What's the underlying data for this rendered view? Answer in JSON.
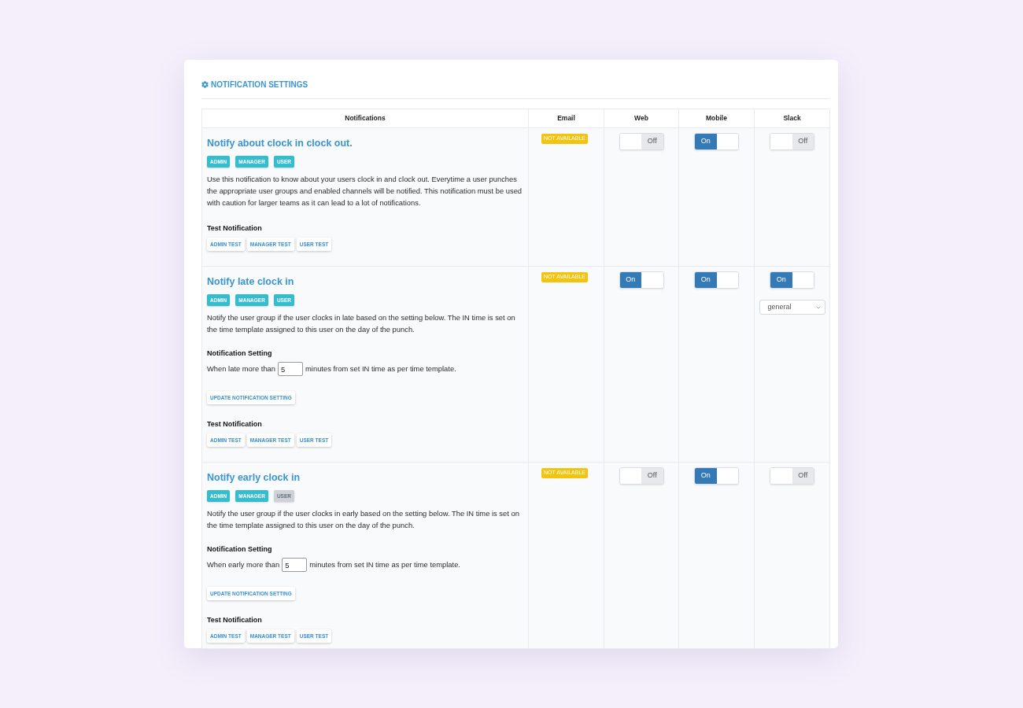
{
  "header": {
    "title": "NOTIFICATION SETTINGS"
  },
  "table": {
    "columns": [
      "Notifications",
      "Email",
      "Web",
      "Mobile",
      "Slack"
    ],
    "rows": [
      {
        "title": "Notify about clock in clock out.",
        "roles": [
          {
            "label": "ADMIN",
            "enabled": true
          },
          {
            "label": "MANAGER",
            "enabled": true
          },
          {
            "label": "USER",
            "enabled": true
          }
        ],
        "description": "Use this notification to know about your users clock in and clock out. Everytime a user punches the appropriate user groups and enabled channels will be notified. This notification must be used with caution for larger teams as it can lead to a lot of notifications.",
        "test": {
          "heading": "Test Notification",
          "buttons": [
            "ADMIN TEST",
            "MANAGER TEST",
            "USER TEST"
          ]
        },
        "channels": [
          {
            "kind": "badge",
            "label": "NOT AVAILABLE"
          },
          {
            "kind": "toggle",
            "label": "Off",
            "on": false
          },
          {
            "kind": "toggle",
            "label": "On",
            "on": true
          },
          {
            "kind": "toggle",
            "label": "Off",
            "on": false
          }
        ]
      },
      {
        "title": "Notify late clock in",
        "roles": [
          {
            "label": "ADMIN",
            "enabled": true
          },
          {
            "label": "MANAGER",
            "enabled": true
          },
          {
            "label": "USER",
            "enabled": true
          }
        ],
        "description": "Notify the user group if the user clocks in late based on the setting below. The IN time is set on the time template assigned to this user on the day of the punch.",
        "setting": {
          "heading": "Notification Setting",
          "prefix": "When late more than",
          "value": "5",
          "suffix": "minutes from set IN time as per time template.",
          "button": "UPDATE NOTIFICATION SETTING"
        },
        "test": {
          "heading": "Test Notification",
          "buttons": [
            "ADMIN TEST",
            "MANAGER TEST",
            "USER TEST"
          ]
        },
        "channels": [
          {
            "kind": "badge",
            "label": "NOT AVAILABLE"
          },
          {
            "kind": "toggle",
            "label": "On",
            "on": true
          },
          {
            "kind": "toggle",
            "label": "On",
            "on": true
          },
          {
            "kind": "toggle",
            "label": "On",
            "on": true,
            "select": "general"
          }
        ]
      },
      {
        "title": "Notify early clock in",
        "roles": [
          {
            "label": "ADMIN",
            "enabled": true
          },
          {
            "label": "MANAGER",
            "enabled": true
          },
          {
            "label": "USER",
            "enabled": false
          }
        ],
        "description": "Notify the user group if the user clocks in early based on the setting below. The IN time is set on the time template assigned to this user on the day of the punch.",
        "setting": {
          "heading": "Notification Setting",
          "prefix": "When early more than",
          "value": "5",
          "suffix": "minutes from set IN time as per time template.",
          "button": "UPDATE NOTIFICATION SETTING"
        },
        "test": {
          "heading": "Test Notification",
          "buttons": [
            "ADMIN TEST",
            "MANAGER TEST",
            "USER TEST"
          ]
        },
        "channels": [
          {
            "kind": "badge",
            "label": "NOT AVAILABLE"
          },
          {
            "kind": "toggle",
            "label": "Off",
            "on": false
          },
          {
            "kind": "toggle",
            "label": "On",
            "on": true
          },
          {
            "kind": "toggle",
            "label": "Off",
            "on": false
          }
        ]
      }
    ]
  }
}
